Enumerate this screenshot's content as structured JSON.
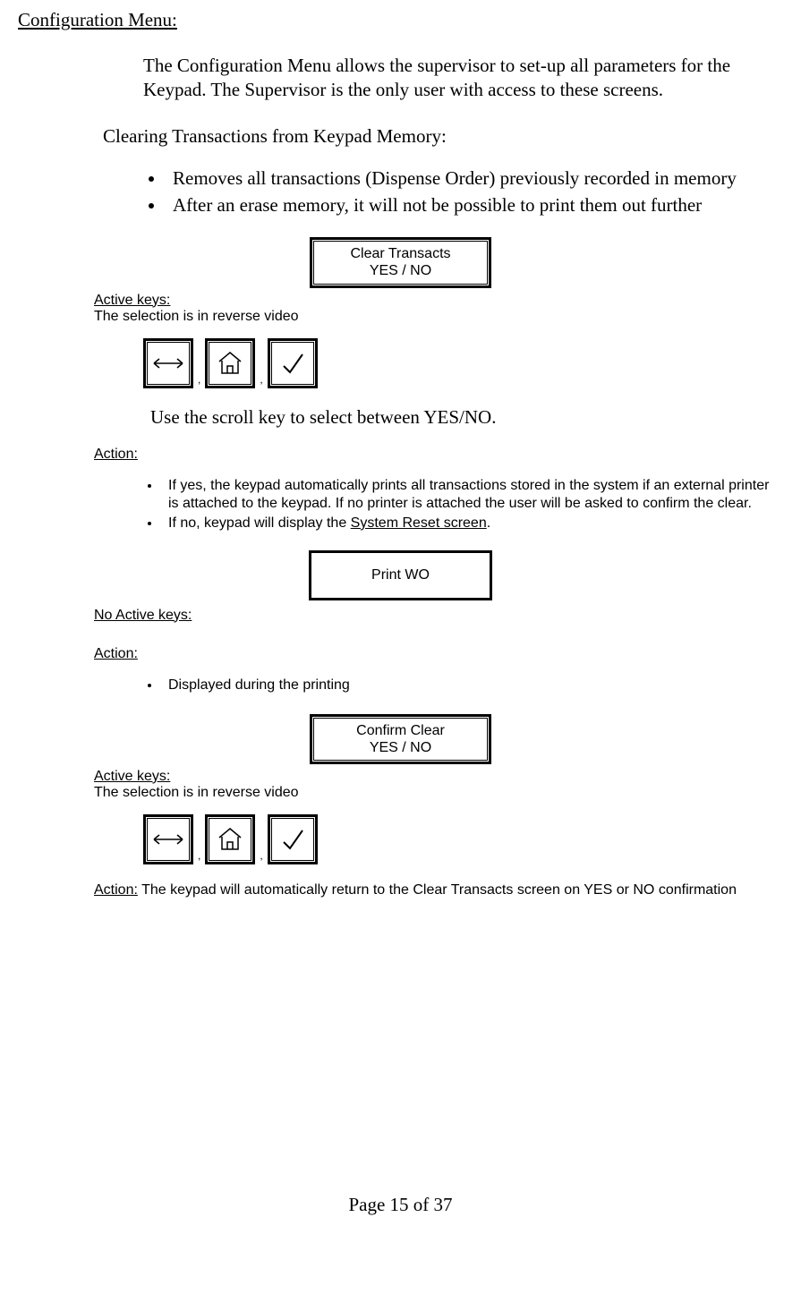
{
  "header": {
    "title": "Configuration Menu:"
  },
  "intro": {
    "text": "The Configuration Menu allows the supervisor to set-up all parameters for the Keypad.  The Supervisor is the only user with access to these screens."
  },
  "subheading": "Clearing Transactions from Keypad Memory:",
  "main_bullets": [
    "Removes all transactions (Dispense Order) previously recorded in memory",
    "After an erase memory, it will not be possible to print them out further"
  ],
  "lcd1": {
    "line1": "Clear Transacts",
    "line2": "YES / NO"
  },
  "labels": {
    "active_keys": "Active keys:",
    "reverse_video": "The selection is in reverse video",
    "no_active_keys": "No Active keys:",
    "action": "Action:"
  },
  "icons": {
    "scroll": "scroll-icon",
    "home": "home-icon",
    "check": "check-icon"
  },
  "scroll_note": "Use the scroll key to select between YES/NO.",
  "action1_bullets": [
    "If yes, the keypad automatically prints all transactions stored in the system if an external printer is attached to the keypad.  If no printer is attached the user will be asked to confirm the clear.",
    {
      "prefix": "If no, keypad will display the ",
      "underlined": "System Reset screen",
      "suffix": "."
    }
  ],
  "lcd2": {
    "line1": "Print WO"
  },
  "action2_bullets": [
    "Displayed during the printing"
  ],
  "lcd3": {
    "line1": "Confirm Clear",
    "line2": "YES /  NO"
  },
  "action3_text": " The keypad will automatically return to the Clear Transacts screen on YES or NO confirmation",
  "footer": {
    "text": "Page 15 of 37"
  }
}
